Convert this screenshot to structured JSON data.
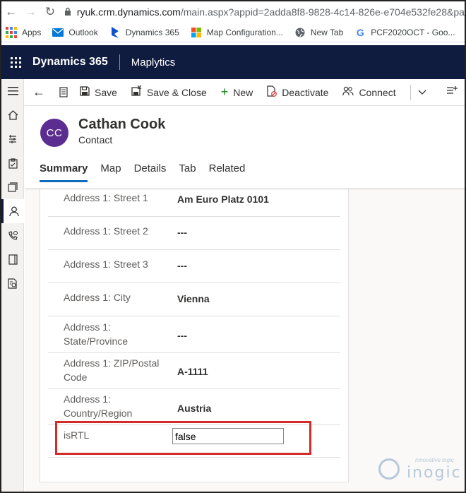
{
  "browser": {
    "url_host": "ryuk.crm.dynamics.com",
    "url_rest": "/main.aspx?appid=2adda8f8-9828-4c14-826e-e704e532fe28&pag",
    "bookmarks": [
      {
        "label": "Apps",
        "icon": "apps-grid-icon"
      },
      {
        "label": "Outlook",
        "icon": "mail-icon",
        "color": "#0078d4"
      },
      {
        "label": "Dynamics 365",
        "icon": "dynamics-icon",
        "color": "#0b53ce"
      },
      {
        "label": "Map Configuration...",
        "icon": "windows-icon"
      },
      {
        "label": "New Tab",
        "icon": "globe-icon"
      },
      {
        "label": "PCF2020OCT - Goo...",
        "icon": "google-icon"
      }
    ]
  },
  "nav": {
    "product": "Dynamics 365",
    "app": "Maplytics"
  },
  "commands": {
    "save": "Save",
    "save_close": "Save & Close",
    "new": "New",
    "deactivate": "Deactivate",
    "connect": "Connect"
  },
  "record": {
    "initials": "CC",
    "avatar_color": "#5c2d91",
    "name": "Cathan Cook",
    "entity": "Contact"
  },
  "tabs": [
    {
      "label": "Summary",
      "active": true
    },
    {
      "label": "Map",
      "active": false
    },
    {
      "label": "Details",
      "active": false
    },
    {
      "label": "Tab",
      "active": false
    },
    {
      "label": "Related",
      "active": false
    }
  ],
  "fields": [
    {
      "label": "Address 1: Street 1",
      "value": "Am Euro Platz 0101"
    },
    {
      "label": "Address 1: Street 2",
      "value": "---"
    },
    {
      "label": "Address 1: Street 3",
      "value": "---"
    },
    {
      "label": "Address 1: City",
      "value": "Vienna"
    },
    {
      "label": "Address 1: State/Province",
      "value": "---"
    },
    {
      "label": "Address 1: ZIP/Postal Code",
      "value": "A-1111"
    },
    {
      "label": "Address 1: Country/Region",
      "value": "Austria"
    }
  ],
  "isrtl": {
    "label": "isRTL",
    "value": "false"
  },
  "watermark": {
    "tagline": "innovative logic",
    "brand": "inogic"
  }
}
